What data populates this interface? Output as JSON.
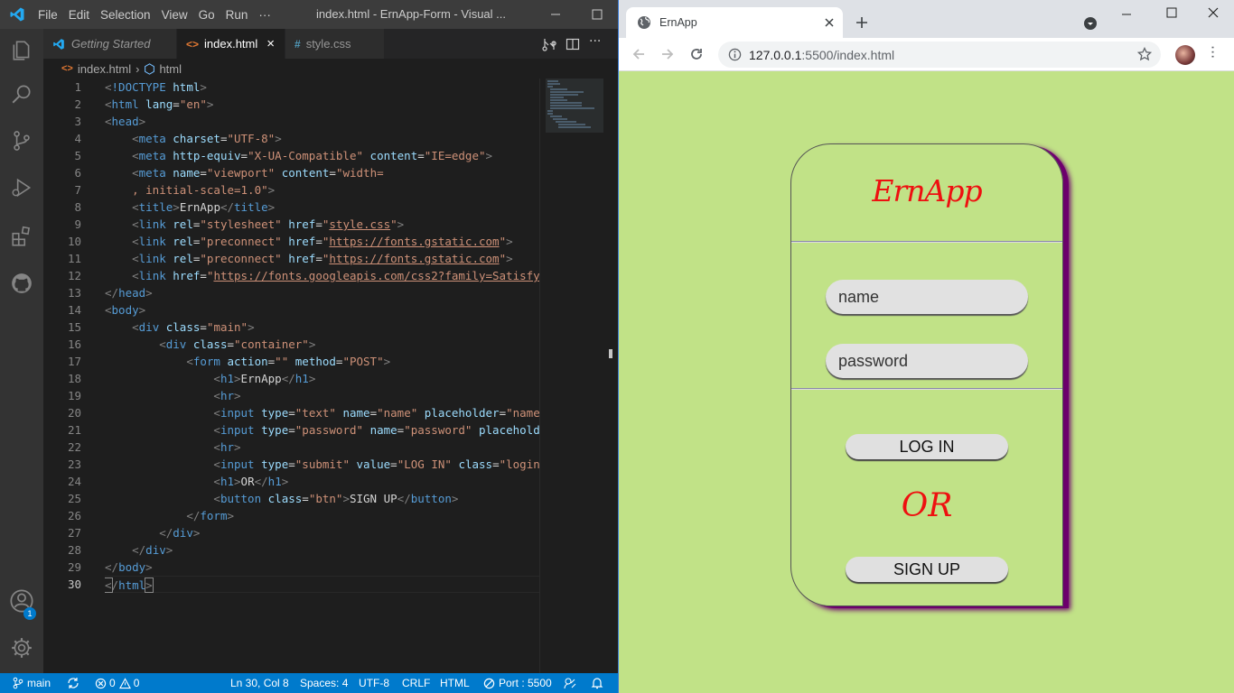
{
  "vscode": {
    "menu": [
      "File",
      "Edit",
      "Selection",
      "View",
      "Go",
      "Run",
      "···"
    ],
    "window_title": "index.html - ErnApp-Form - Visual ...",
    "tabs": [
      {
        "label": "Getting Started",
        "icon": "vscode-icon",
        "active": false
      },
      {
        "label": "index.html",
        "icon": "html-icon",
        "active": true
      },
      {
        "label": "style.css",
        "icon": "css-icon",
        "active": false
      }
    ],
    "breadcrumb": {
      "file": "index.html",
      "symbol": "html"
    },
    "current_line": 30,
    "code_lines": [
      "1",
      "2",
      "3",
      "4",
      "5",
      "6",
      "7",
      "8",
      "9",
      "10",
      "11",
      "12",
      "13",
      "14",
      "15",
      "16",
      "17",
      "18",
      "19",
      "20",
      "21",
      "22",
      "23",
      "24",
      "25",
      "26",
      "27",
      "28",
      "29",
      "30"
    ],
    "status": {
      "branch": "main",
      "errors": "0",
      "warnings": "0",
      "position": "Ln 30, Col 8",
      "spaces": "Spaces: 4",
      "encoding": "UTF-8",
      "eol": "CRLF",
      "language": "HTML",
      "port": "Port : 5500"
    },
    "accounts_badge": "1",
    "accent": "#007acc"
  },
  "browser": {
    "tab_title": "ErnApp",
    "url_host": "127.0.0.1",
    "url_rest": ":5500/index.html",
    "page_bg": "#c1e287"
  },
  "form": {
    "heading": "ErnApp",
    "name_placeholder": "name",
    "password_placeholder": "password",
    "login_label": "LOG IN",
    "or_label": "OR",
    "signup_label": "SIGN UP",
    "heading_color": "#ee1010",
    "shadow_color": "#7a007a"
  }
}
